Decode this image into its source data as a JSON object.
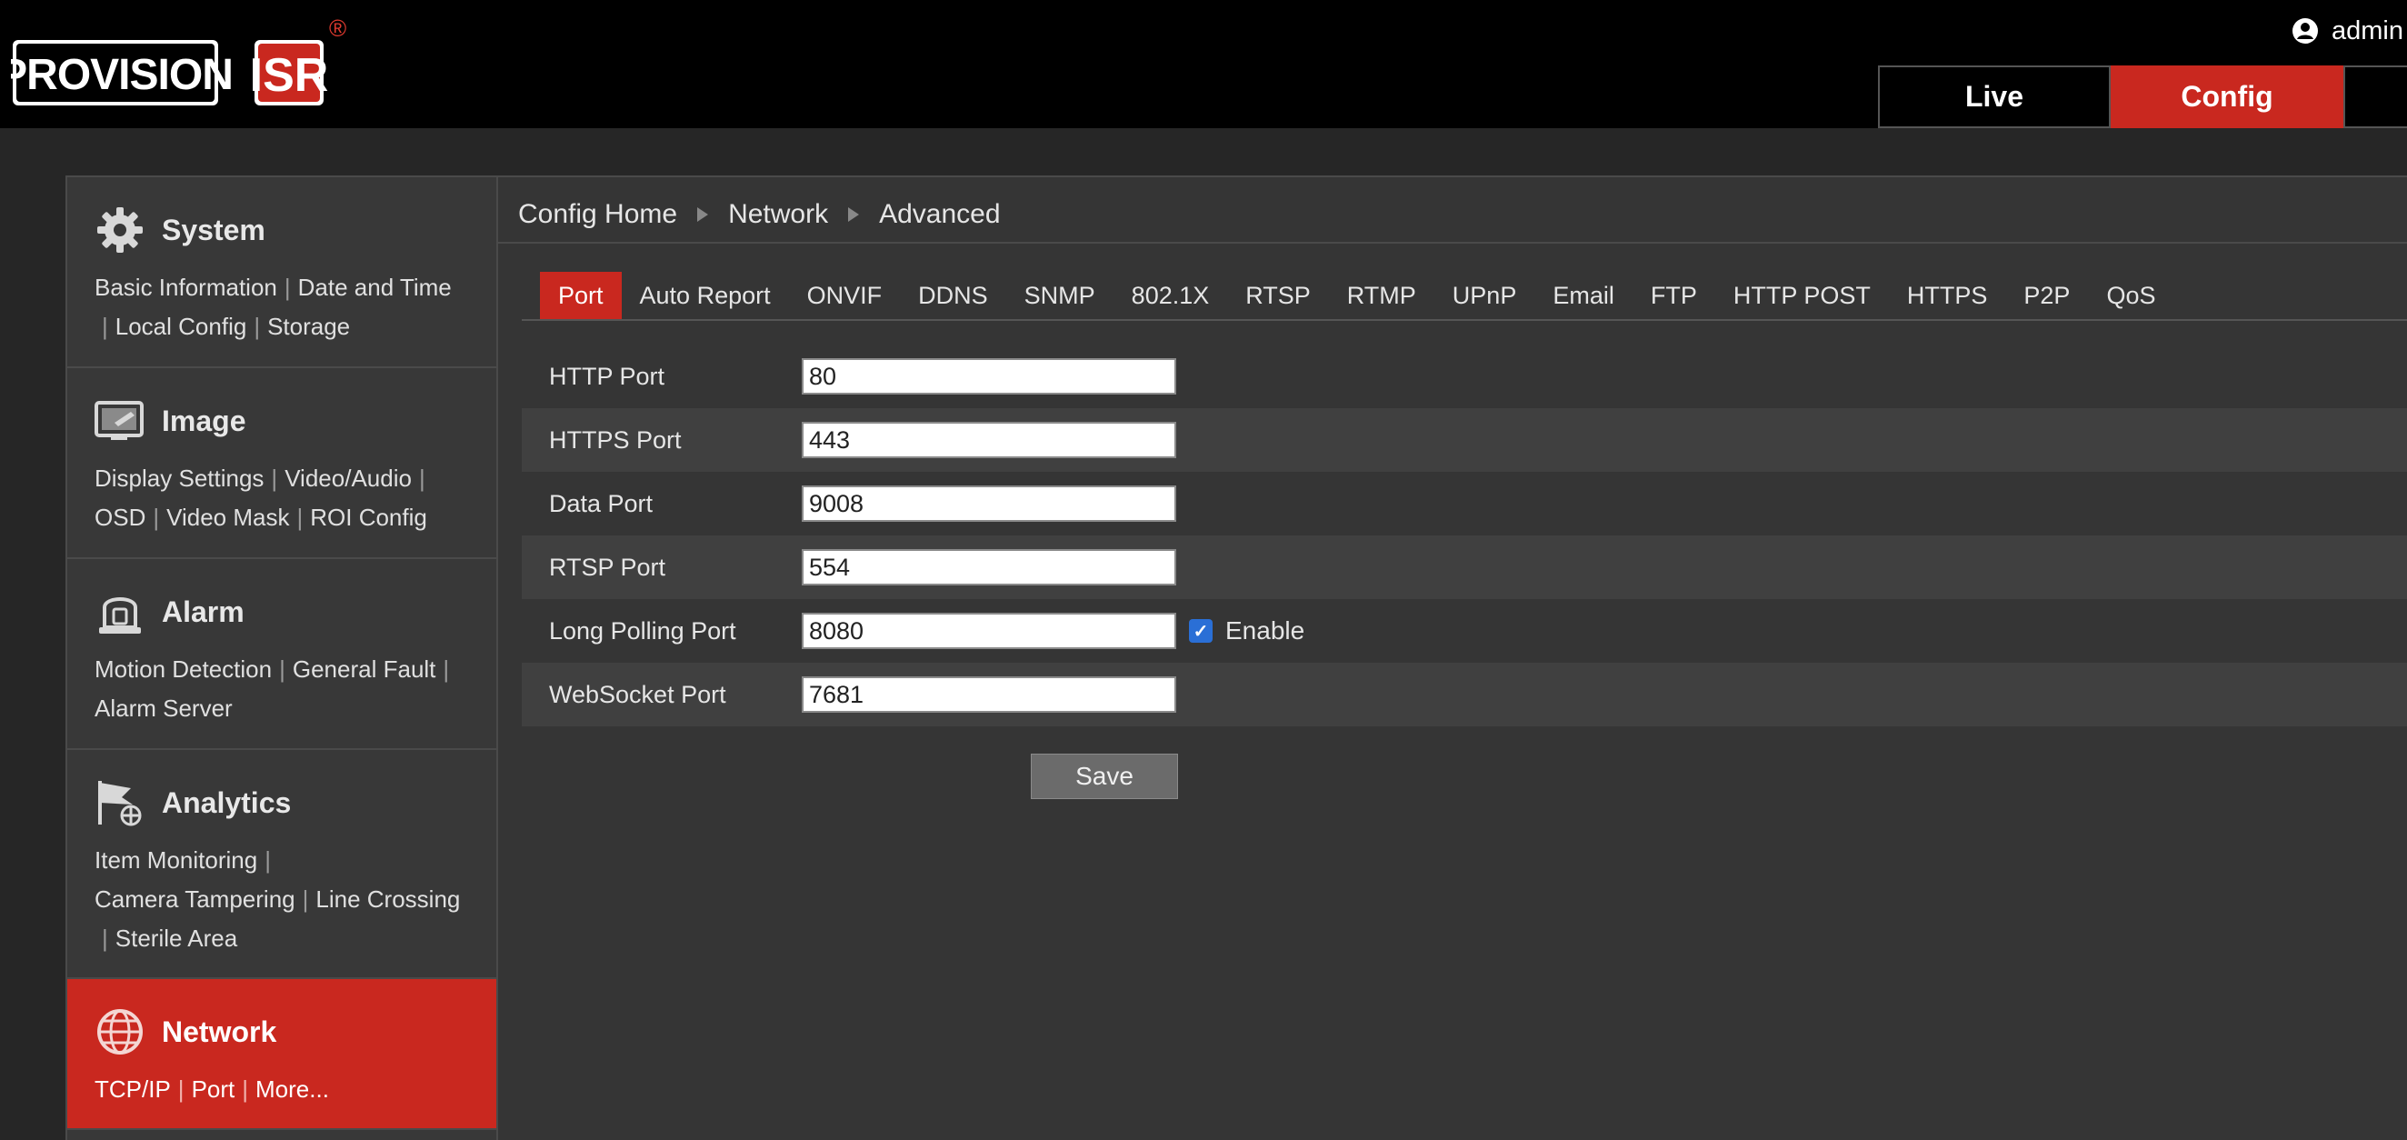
{
  "header": {
    "brand": "PROVISION ISR",
    "registered_mark": "®",
    "user_name": "admin",
    "tabs": [
      {
        "label": "Live"
      },
      {
        "label": "Config"
      },
      {
        "label": ""
      }
    ]
  },
  "sidebar": {
    "sections": [
      {
        "title": "System",
        "icon": "gear-icon",
        "links": [
          "Basic Information",
          "Date and Time",
          "Local Config",
          "Storage"
        ]
      },
      {
        "title": "Image",
        "icon": "image-settings-icon",
        "links": [
          "Display Settings",
          "Video/Audio",
          "OSD",
          "Video Mask",
          "ROI Config"
        ]
      },
      {
        "title": "Alarm",
        "icon": "alarm-bell-icon",
        "links": [
          "Motion Detection",
          "General Fault",
          "Alarm Server"
        ]
      },
      {
        "title": "Analytics",
        "icon": "analytics-flag-icon",
        "links": [
          "Item Monitoring",
          "Camera Tampering",
          "Line Crossing",
          "Sterile Area"
        ]
      },
      {
        "title": "Network",
        "icon": "globe-icon",
        "links": [
          "TCP/IP",
          "Port",
          "More..."
        ]
      }
    ]
  },
  "main": {
    "breadcrumb": [
      "Config Home",
      "Network",
      "Advanced"
    ],
    "subtabs": [
      "Port",
      "Auto Report",
      "ONVIF",
      "DDNS",
      "SNMP",
      "802.1X",
      "RTSP",
      "RTMP",
      "UPnP",
      "Email",
      "FTP",
      "HTTP POST",
      "HTTPS",
      "P2P",
      "QoS"
    ],
    "active_subtab": "Port",
    "fields": [
      {
        "label": "HTTP Port",
        "value": "80"
      },
      {
        "label": "HTTPS Port",
        "value": "443"
      },
      {
        "label": "Data Port",
        "value": "9008"
      },
      {
        "label": "RTSP Port",
        "value": "554"
      },
      {
        "label": "Long Polling Port",
        "value": "8080",
        "checkbox_label": "Enable",
        "checked": true
      },
      {
        "label": "WebSocket Port",
        "value": "7681"
      }
    ],
    "save_label": "Save"
  },
  "colors": {
    "accent_red": "#c9281f",
    "header_bg": "#000000",
    "panel_bg": "#353535",
    "sidebar_bg": "#383838"
  }
}
